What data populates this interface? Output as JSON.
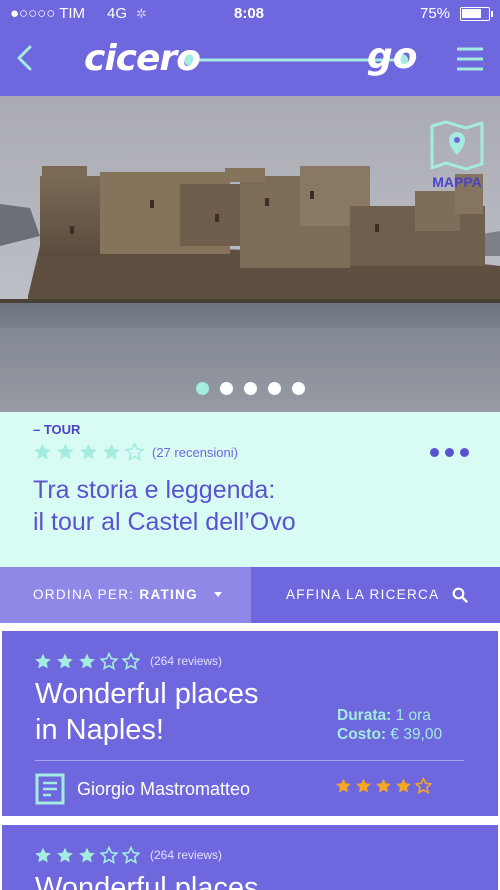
{
  "status_bar": {
    "carrier": "●○○○○ TIM",
    "network": "4G",
    "time": "8:08",
    "battery": "75%"
  },
  "header": {
    "logo_left": "cicero",
    "logo_right": "go",
    "back_icon": "chevron-left-icon",
    "menu_icon": "hamburger-menu-icon"
  },
  "hero": {
    "map_label": "MAPPA",
    "map_icon": "map-pin-icon",
    "carousel_pages": 5,
    "carousel_active": 1
  },
  "tour": {
    "tag": "– TOUR",
    "rating": 4,
    "rating_max": 5,
    "reviews": "(27 recensioni)",
    "title_line1": "Tra storia e leggenda:",
    "title_line2": "il tour al Castel dell’Ovo"
  },
  "filters": {
    "sort_prefix": "ORDINA PER:",
    "sort_value": "RATING",
    "refine_label": "AFFINA LA RICERCA",
    "search_icon": "search-icon"
  },
  "cards": [
    {
      "rating": 3,
      "rating_max": 5,
      "reviews": "(264 reviews)",
      "title_line1": "Wonderful places",
      "title_line2": "in Naples!",
      "duration_label": "Durata:",
      "duration_value": "1 ora",
      "cost_label": "Costo:",
      "cost_value": "€ 39,00",
      "author": "Giorgio Mastromatteo",
      "author_rating": 4,
      "author_rating_max": 5
    },
    {
      "rating": 3,
      "rating_max": 5,
      "reviews": "(264 reviews)",
      "title_line1": "Wonderful places"
    }
  ],
  "colors": {
    "primary": "#6e67de",
    "primary_light": "#8f88e6",
    "mint": "#a3ecdf",
    "mint_bg": "#d8fbf3",
    "dark_text": "#5a53d0",
    "gold": "#f5a623"
  }
}
